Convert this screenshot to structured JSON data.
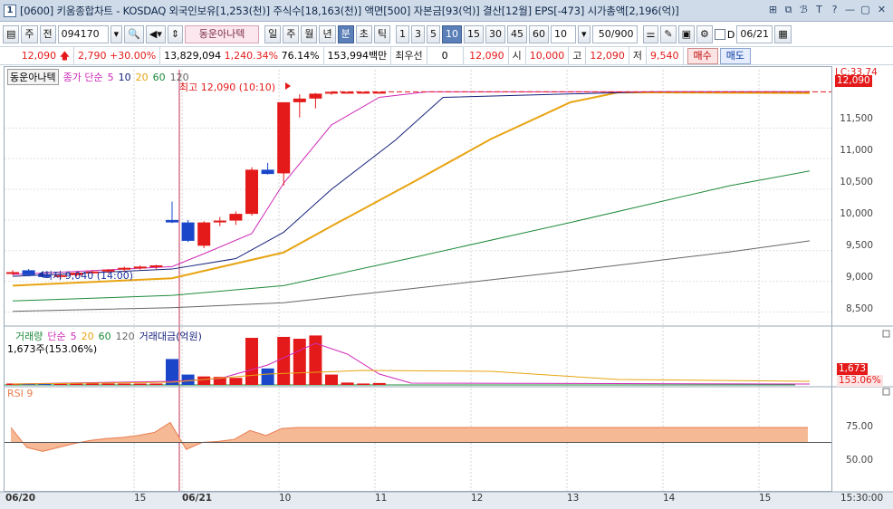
{
  "window": {
    "number": "1",
    "title": "[0600] 키움종합차트 - KOSDAQ 외국인보유[1,253(천)] 주식수[18,163(천)] 액면[500] 자본금[93(억)] 결산[12월] EPS[-473] 시가총액[2,196(억)]",
    "buttons": [
      "⊞",
      "⧉",
      "ℬ",
      "T",
      "?",
      "—",
      "▢",
      "✕"
    ]
  },
  "toolbar": {
    "period_type": "주",
    "all_label": "전",
    "code": "094170",
    "name": "동운아나텍",
    "periods": [
      "일",
      "주",
      "월",
      "년",
      "분",
      "초",
      "틱"
    ],
    "selected_period": "분",
    "intervals": [
      "1",
      "3",
      "5",
      "10",
      "15",
      "30",
      "45",
      "60"
    ],
    "selected_interval": "10",
    "count": "10",
    "range": "50/900",
    "date_label": "D",
    "date": "06/21"
  },
  "quote": {
    "price": "12,090",
    "change": "2,790",
    "change_pct": "+30.00%",
    "volume": "13,829,094",
    "volume_ratio": "1,240.34%",
    "turnover": "76.14%",
    "amount": "153,994백만",
    "priority_label": "최우선",
    "priority_value": "0",
    "current": "12,090",
    "open_label": "시",
    "open": "10,000",
    "high_label": "고",
    "high": "12,090",
    "low_label": "저",
    "low": "9,540",
    "buy_label": "매수",
    "sell_label": "매도"
  },
  "price_panel": {
    "legend": {
      "name": "동운아나텍",
      "ma_title": "종가 단순",
      "ma5": "5",
      "ma10": "10",
      "ma20": "20",
      "ma60": "60",
      "ma120": "120"
    },
    "high_annot": "최고 12,090 (10:10)",
    "low_annot": "최저 9,040 (14:00)",
    "lc_label": "LC:33.74",
    "price_tag": "12,090",
    "yticks": [
      "11,500",
      "11,000",
      "10,500",
      "10,000",
      "9,500",
      "9,000",
      "8,500"
    ]
  },
  "volume_panel": {
    "legend": {
      "title": "거래량",
      "ma_title": "단순",
      "ma5": "5",
      "ma20": "20",
      "ma60": "60",
      "ma120": "120",
      "amount_title": "거래대금(억원)"
    },
    "value_text": "1,673주(153.06%)",
    "tag_volume": "1,673",
    "tag_pct": "153.06%"
  },
  "rsi_panel": {
    "title": "RSI 9",
    "yticks": [
      "75.00",
      "50.00"
    ]
  },
  "xaxis": {
    "labels": [
      "06/20",
      "15",
      "06/21",
      "10",
      "11",
      "12",
      "13",
      "14",
      "15"
    ],
    "time": "15:30:00"
  },
  "colors": {
    "up": "#e41a1a",
    "down": "#1a47c9",
    "ma5": "#cf2bb8",
    "ma10": "#14207a",
    "ma20": "#e8a412",
    "ma60": "#1d8a3a",
    "ma120": "#666666",
    "rsi_fill": "#f6b995"
  },
  "chart_data": {
    "type": "candlestick",
    "ylim": [
      8300,
      12450
    ],
    "candles": [
      {
        "o": 9140,
        "h": 9180,
        "l": 9100,
        "c": 9150
      },
      {
        "o": 9180,
        "h": 9200,
        "l": 9080,
        "c": 9100
      },
      {
        "o": 9100,
        "h": 9130,
        "l": 9060,
        "c": 9090
      },
      {
        "o": 9090,
        "h": 9120,
        "l": 9040,
        "c": 9100
      },
      {
        "o": 9100,
        "h": 9150,
        "l": 9080,
        "c": 9140
      },
      {
        "o": 9140,
        "h": 9180,
        "l": 9110,
        "c": 9160
      },
      {
        "o": 9160,
        "h": 9200,
        "l": 9130,
        "c": 9190
      },
      {
        "o": 9190,
        "h": 9240,
        "l": 9160,
        "c": 9220
      },
      {
        "o": 9220,
        "h": 9260,
        "l": 9190,
        "c": 9240
      },
      {
        "o": 9240,
        "h": 9270,
        "l": 9200,
        "c": 9260
      },
      {
        "o": 10000,
        "h": 10300,
        "l": 9950,
        "c": 9960
      },
      {
        "o": 9960,
        "h": 10000,
        "l": 9640,
        "c": 9660
      },
      {
        "o": 9580,
        "h": 9980,
        "l": 9540,
        "c": 9960
      },
      {
        "o": 9970,
        "h": 10050,
        "l": 9900,
        "c": 9990
      },
      {
        "o": 9990,
        "h": 10140,
        "l": 9920,
        "c": 10100
      },
      {
        "o": 10100,
        "h": 10860,
        "l": 10070,
        "c": 10820
      },
      {
        "o": 10820,
        "h": 10930,
        "l": 10740,
        "c": 10750
      },
      {
        "o": 10760,
        "h": 11900,
        "l": 10560,
        "c": 11920
      },
      {
        "o": 11920,
        "h": 12050,
        "l": 11670,
        "c": 11980
      },
      {
        "o": 11980,
        "h": 12070,
        "l": 11820,
        "c": 12060
      },
      {
        "o": 12060,
        "h": 12090,
        "l": 12040,
        "c": 12090
      },
      {
        "o": 12090,
        "h": 12090,
        "l": 12090,
        "c": 12090
      },
      {
        "o": 12090,
        "h": 12090,
        "l": 12090,
        "c": 12090
      },
      {
        "o": 12090,
        "h": 12090,
        "l": 12090,
        "c": 12090
      }
    ],
    "ma": {
      "ma5_x": [
        0,
        10,
        12,
        15,
        17,
        20,
        23,
        26,
        40,
        50
      ],
      "ma5_y": [
        9110,
        9240,
        9450,
        9780,
        10600,
        11550,
        12000,
        12090,
        12090,
        12090
      ],
      "ma10_x": [
        0,
        10,
        14,
        17,
        20,
        24,
        27,
        40,
        50
      ],
      "ma10_y": [
        9080,
        9200,
        9370,
        9800,
        10500,
        11300,
        12000,
        12090,
        12090
      ],
      "ma20_x": [
        0,
        10,
        17,
        20,
        25,
        30,
        35,
        38,
        50
      ],
      "ma20_y": [
        8930,
        9050,
        9470,
        9900,
        10600,
        11320,
        11920,
        12080,
        12070
      ],
      "ma60_x": [
        0,
        10,
        17,
        25,
        35,
        45,
        50
      ],
      "ma60_y": [
        8680,
        8770,
        8930,
        9380,
        9960,
        10560,
        10800
      ],
      "ma120_x": [
        0,
        10,
        17,
        25,
        35,
        45,
        50
      ],
      "ma120_y": [
        8510,
        8570,
        8650,
        8880,
        9170,
        9480,
        9660
      ]
    },
    "volume": [
      0.03,
      0.03,
      0.03,
      0.03,
      0.03,
      0.03,
      0.03,
      0.03,
      0.03,
      0.03,
      0.55,
      0.22,
      0.18,
      0.17,
      0.15,
      1.0,
      0.35,
      1.02,
      0.98,
      1.05,
      0.22,
      0.05,
      0.03,
      0.04
    ],
    "rsi_x": [
      0,
      1,
      2,
      3,
      4,
      5,
      6,
      7,
      8,
      9,
      10,
      11,
      12,
      13,
      14,
      15,
      16,
      17,
      18,
      19,
      20,
      50
    ],
    "rsi_y": [
      90,
      70,
      66,
      70,
      74,
      77,
      79,
      80,
      82,
      85,
      95,
      68,
      75,
      76,
      78,
      87,
      82,
      89,
      90,
      90,
      90,
      90
    ]
  }
}
